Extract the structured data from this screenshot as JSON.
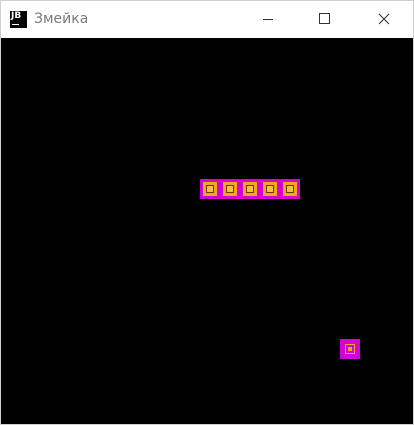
{
  "window": {
    "title": "Змейка",
    "icon": "jetbrains-logo-icon",
    "icon_text": "JB",
    "controls": [
      "minimize-icon",
      "maximize-icon",
      "close-icon"
    ]
  },
  "game": {
    "background": "#000000",
    "snake_color": "#d400d4",
    "segment_accent": "#f2a81e",
    "food_color": "#d400d4",
    "snake_length": 5
  }
}
